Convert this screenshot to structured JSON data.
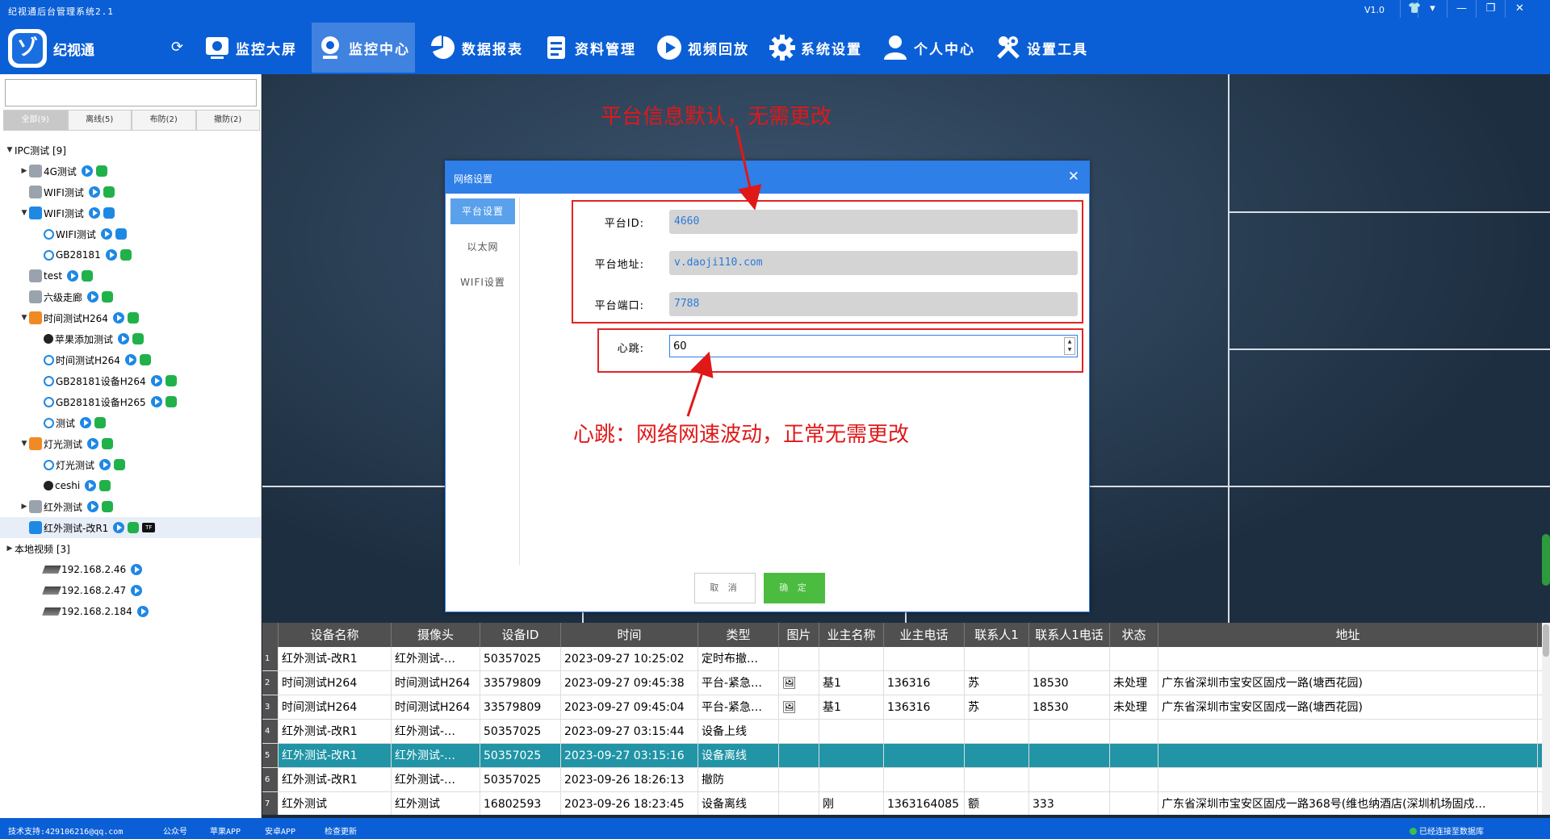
{
  "window": {
    "title": "纪视通后台管理系统2.1",
    "version": "V1.0"
  },
  "app": {
    "name": "纪视通"
  },
  "nav": [
    {
      "label": "监控大屏",
      "icon": "monitor-icon"
    },
    {
      "label": "监控中心",
      "icon": "camera-icon",
      "active": true
    },
    {
      "label": "数据报表",
      "icon": "pie-chart-icon"
    },
    {
      "label": "资料管理",
      "icon": "document-icon"
    },
    {
      "label": "视频回放",
      "icon": "play-circle-icon"
    },
    {
      "label": "系统设置",
      "icon": "gear-icon"
    },
    {
      "label": "个人中心",
      "icon": "user-icon"
    },
    {
      "label": "设置工具",
      "icon": "tools-icon"
    }
  ],
  "filter_tabs": [
    "全部(9)",
    "离线(5)",
    "布防(2)",
    "撤防(2)"
  ],
  "tree": [
    {
      "label": "IPC测试 [9]",
      "indent": 0,
      "arrow": "▼",
      "icon": "none"
    },
    {
      "label": "4G测试",
      "indent": 1,
      "arrow": "▶",
      "icon": "gray",
      "badges": [
        "play",
        "android"
      ]
    },
    {
      "label": "WIFI测试",
      "indent": 1,
      "arrow": "",
      "icon": "gray",
      "badges": [
        "play",
        "android"
      ]
    },
    {
      "label": "WIFI测试",
      "indent": 1,
      "arrow": "▼",
      "icon": "blue",
      "badges": [
        "play",
        "wifi"
      ]
    },
    {
      "label": "WIFI测试",
      "indent": 2,
      "arrow": "",
      "icon": "round",
      "badges": [
        "play",
        "wifi"
      ]
    },
    {
      "label": "GB28181",
      "indent": 2,
      "arrow": "",
      "icon": "round",
      "badges": [
        "play",
        "android"
      ]
    },
    {
      "label": "test",
      "indent": 1,
      "arrow": "",
      "icon": "gray",
      "badges": [
        "play",
        "android"
      ]
    },
    {
      "label": "六级走廊",
      "indent": 1,
      "arrow": "",
      "icon": "gray",
      "badges": [
        "play",
        "android"
      ]
    },
    {
      "label": "时间测试H264",
      "indent": 1,
      "arrow": "▼",
      "icon": "orange",
      "badges": [
        "play",
        "android"
      ]
    },
    {
      "label": "苹果添加测试",
      "indent": 2,
      "arrow": "",
      "icon": "dark",
      "badges": [
        "play",
        "android"
      ]
    },
    {
      "label": "时间测试H264",
      "indent": 2,
      "arrow": "",
      "icon": "round",
      "badges": [
        "play",
        "android"
      ]
    },
    {
      "label": "GB28181设备H264",
      "indent": 2,
      "arrow": "",
      "icon": "round",
      "badges": [
        "play",
        "android"
      ]
    },
    {
      "label": "GB28181设备H265",
      "indent": 2,
      "arrow": "",
      "icon": "round",
      "badges": [
        "play",
        "android"
      ]
    },
    {
      "label": "测试",
      "indent": 2,
      "arrow": "",
      "icon": "round",
      "badges": [
        "play",
        "android"
      ]
    },
    {
      "label": "灯光测试",
      "indent": 1,
      "arrow": "▼",
      "icon": "orange",
      "badges": [
        "play",
        "android"
      ]
    },
    {
      "label": "灯光测试",
      "indent": 2,
      "arrow": "",
      "icon": "round",
      "badges": [
        "play",
        "android"
      ]
    },
    {
      "label": "ceshi",
      "indent": 2,
      "arrow": "",
      "icon": "dark",
      "badges": [
        "play",
        "android"
      ]
    },
    {
      "label": "红外测试",
      "indent": 1,
      "arrow": "▶",
      "icon": "gray",
      "badges": [
        "play",
        "android"
      ]
    },
    {
      "label": "红外测试-改R1",
      "indent": 1,
      "arrow": "",
      "icon": "blue",
      "badges": [
        "play",
        "android",
        "tf"
      ],
      "selected": true
    },
    {
      "label": "本地视频 [3]",
      "indent": 0,
      "arrow": "▶",
      "icon": "none"
    },
    {
      "label": "192.168.2.46",
      "indent": 2,
      "arrow": "",
      "icon": "net",
      "badges": [
        "play"
      ]
    },
    {
      "label": "192.168.2.47",
      "indent": 2,
      "arrow": "",
      "icon": "net",
      "badges": [
        "play"
      ]
    },
    {
      "label": "192.168.2.184",
      "indent": 2,
      "arrow": "",
      "icon": "net",
      "badges": [
        "play"
      ]
    }
  ],
  "dialog": {
    "title": "网络设置",
    "tabs": [
      "平台设置",
      "以太网",
      "WIFI设置"
    ],
    "platform_id_label": "平台ID:",
    "platform_id": "4660",
    "platform_addr_label": "平台地址:",
    "platform_addr": "v.daoji110.com",
    "platform_port_label": "平台端口:",
    "platform_port": "7788",
    "heartbeat_label": "心跳:",
    "heartbeat": "60",
    "cancel": "取 消",
    "ok": "确 定"
  },
  "annotations": {
    "platform_note": "平台信息默认，无需更改",
    "heartbeat_note": "心跳：网络网速波动，正常无需更改"
  },
  "table": {
    "headers": [
      "设备名称",
      "摄像头",
      "设备ID",
      "时间",
      "类型",
      "图片",
      "业主名称",
      "业主电话",
      "联系人1",
      "联系人1电话",
      "状态",
      "地址"
    ],
    "rows": [
      {
        "idx": "1",
        "cells": [
          "红外测试-改R1",
          "红外测试-…",
          "50357025",
          "2023-09-27  10:25:02",
          "定时布撤…",
          "",
          "",
          "",
          "",
          "",
          "",
          ""
        ]
      },
      {
        "idx": "2",
        "cells": [
          "时间测试H264",
          "时间测试H264",
          "33579809",
          "2023-09-27  09:45:38",
          "平台-紧急…",
          "🖼",
          "基1",
          "136316",
          "苏",
          "18530",
          "未处理",
          "广东省深圳市宝安区固戍一路(塘西花园)"
        ]
      },
      {
        "idx": "3",
        "cells": [
          "时间测试H264",
          "时间测试H264",
          "33579809",
          "2023-09-27  09:45:04",
          "平台-紧急…",
          "🖼",
          "基1",
          "136316",
          "苏",
          "18530",
          "未处理",
          "广东省深圳市宝安区固戍一路(塘西花园)"
        ]
      },
      {
        "idx": "4",
        "cells": [
          "红外测试-改R1",
          "红外测试-…",
          "50357025",
          "2023-09-27  03:15:44",
          "设备上线",
          "",
          "",
          "",
          "",
          "",
          "",
          ""
        ]
      },
      {
        "idx": "5",
        "cells": [
          "红外测试-改R1",
          "红外测试-…",
          "50357025",
          "2023-09-27  03:15:16",
          "设备离线",
          "",
          "",
          "",
          "",
          "",
          "",
          ""
        ],
        "selected": true
      },
      {
        "idx": "6",
        "cells": [
          "红外测试-改R1",
          "红外测试-…",
          "50357025",
          "2023-09-26  18:26:13",
          "撤防",
          "",
          "",
          "",
          "",
          "",
          "",
          ""
        ]
      },
      {
        "idx": "7",
        "cells": [
          "红外测试",
          "红外测试",
          "16802593",
          "2023-09-26  18:23:45",
          "设备离线",
          "",
          "刚",
          "1363164085",
          "额",
          "333",
          "",
          "广东省深圳市宝安区固戍一路368号(维也纳酒店(深圳机场固戍…"
        ]
      }
    ]
  },
  "status": {
    "support": "技术支持:429106216@qq.com",
    "links": [
      "公众号",
      "苹果APP",
      "安卓APP",
      "检查更新"
    ],
    "connection": "已经连接至数据库"
  },
  "colors": {
    "brand": "#0b5fd6",
    "dialog_header": "#2f7fe8",
    "annotation": "#e01818",
    "selected_row": "#2194a6",
    "ok_button": "#4cbc41"
  }
}
